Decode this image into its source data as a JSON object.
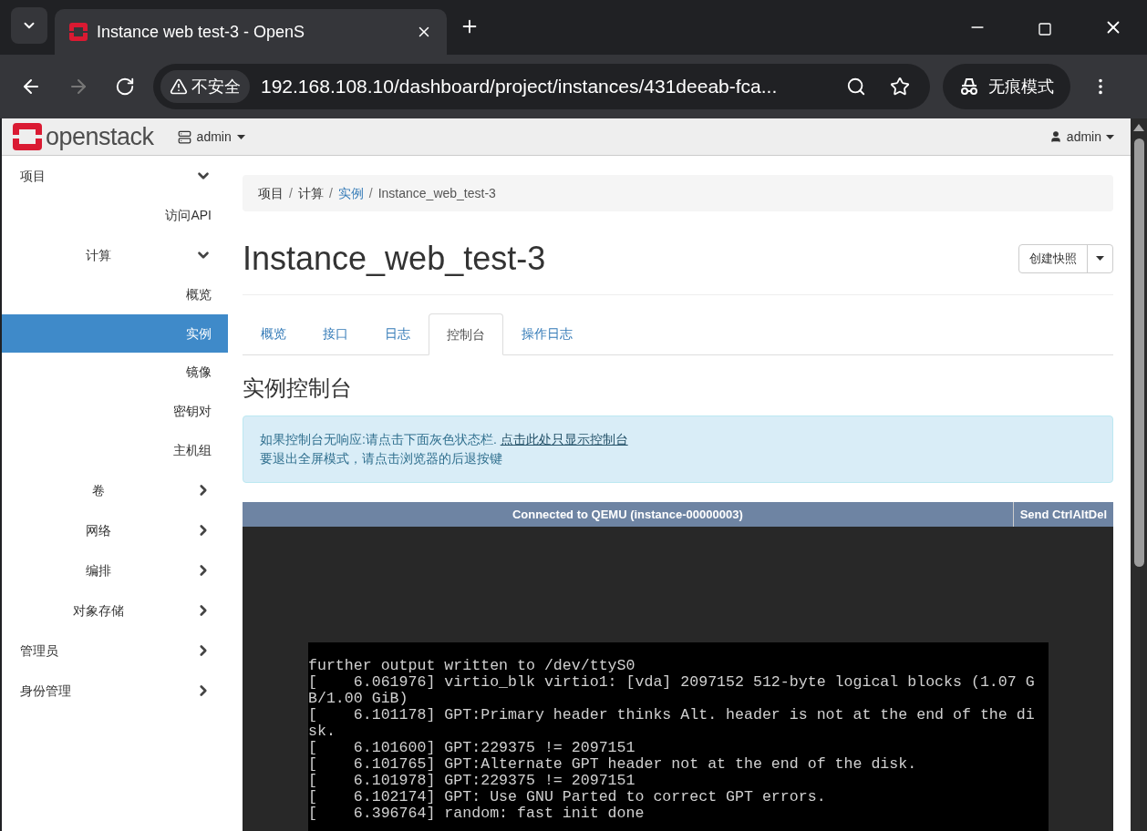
{
  "browser": {
    "tab_title": "Instance web test-3 - OpenS",
    "address_security": "不安全",
    "url": "192.168.108.10/dashboard/project/instances/431deeab-fca...",
    "incognito": "无痕模式"
  },
  "topbar": {
    "logo": "openstack",
    "project_menu": "admin",
    "user_menu": "admin"
  },
  "sidebar": [
    {
      "label": "项目",
      "kind": "section",
      "expanded": true,
      "children": [
        {
          "label": "访问API",
          "kind": "link",
          "selected": false
        },
        {
          "label": "计算",
          "kind": "group",
          "expanded": true,
          "children": [
            {
              "label": "概览",
              "kind": "link",
              "selected": false
            },
            {
              "label": "实例",
              "kind": "link",
              "selected": true
            },
            {
              "label": "镜像",
              "kind": "link",
              "selected": false
            },
            {
              "label": "密钥对",
              "kind": "link",
              "selected": false
            },
            {
              "label": "主机组",
              "kind": "link",
              "selected": false
            }
          ]
        },
        {
          "label": "卷",
          "kind": "group",
          "expanded": false
        },
        {
          "label": "网络",
          "kind": "group",
          "expanded": false
        },
        {
          "label": "编排",
          "kind": "group",
          "expanded": false
        },
        {
          "label": "对象存储",
          "kind": "group",
          "expanded": false
        }
      ]
    },
    {
      "label": "管理员",
      "kind": "section",
      "expanded": false
    },
    {
      "label": "身份管理",
      "kind": "section",
      "expanded": false
    }
  ],
  "breadcrumb": [
    {
      "label": "项目",
      "kind": "text",
      "separator": "/"
    },
    {
      "label": "计算",
      "kind": "text",
      "separator": "/"
    },
    {
      "label": "实例",
      "kind": "link",
      "separator": "/"
    },
    {
      "label": "Instance_web_test-3",
      "kind": "current"
    }
  ],
  "page_title": "Instance_web_test-3",
  "action_button": "创建快照",
  "tabs": [
    {
      "label": "概览",
      "selected": false
    },
    {
      "label": "接口",
      "selected": false
    },
    {
      "label": "日志",
      "selected": false
    },
    {
      "label": "控制台",
      "selected": true
    },
    {
      "label": "操作日志",
      "selected": false
    }
  ],
  "section_title": "实例控制台",
  "info": {
    "line1": "如果控制台无响应:请点击下面灰色状态栏.",
    "link": "点击此处只显示控制台",
    "line2": "要退出全屏模式，请点击浏览器的后退按键"
  },
  "console": {
    "status": "Connected to QEMU (instance-00000003)",
    "button": "Send CtrlAltDel",
    "lines": [
      "further output written to /dev/ttyS0",
      "[    6.061976] virtio_blk virtio1: [vda] 2097152 512-byte logical blocks (1.07 G",
      "B/1.00 GiB)",
      "[    6.101178] GPT:Primary header thinks Alt. header is not at the end of the di",
      "sk.",
      "[    6.101600] GPT:229375 != 2097151",
      "[    6.101765] GPT:Alternate GPT header not at the end of the disk.",
      "[    6.101978] GPT:229375 != 2097151",
      "[    6.102174] GPT: Use GNU Parted to correct GPT errors.",
      "[    6.396764] random: fast init done"
    ]
  }
}
